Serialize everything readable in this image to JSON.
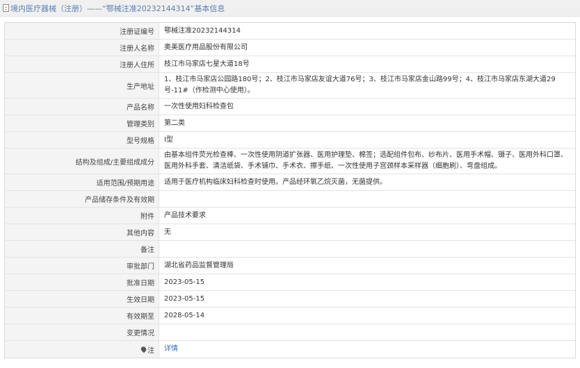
{
  "header": {
    "title": "境内医疗器械（注册）——“鄂械注准20232144314”基本信息"
  },
  "rows": [
    {
      "label": "注册证编号",
      "value": "鄂械注准20232144314"
    },
    {
      "label": "注册人名称",
      "value": "奥美医疗用品股份有限公司"
    },
    {
      "label": "注册人住所",
      "value": "枝江市马家店七星大道18号"
    },
    {
      "label": "生产地址",
      "value": "1、枝江市马家店公园路180号；2、枝江市马家店友谊大道76号；3、枝江市马家店金山路99号；4、枝江市马家店东湖大道29号-11#（作检测中心使用）。"
    },
    {
      "label": "产品名称",
      "value": "一次性使用妇科检查包"
    },
    {
      "label": "管理类别",
      "value": "第二类"
    },
    {
      "label": "型号规格",
      "value": "Ⅰ型"
    },
    {
      "label": "结构及组成/主要组成成分",
      "value": "由基本组件荧光检查棒、一次性使用阴道扩张器、医用护理垫、棉签；选配组件包布、纱布片、医用手术帽、镊子、医用外科口罩、医用外科手套、清洁纸袋、手术铺巾、手术衣、擦手纸、一次性使用子宫颈样本采样器（细胞刷）、弯盘组成。"
    },
    {
      "label": "适用范围/预期用途",
      "value": "适用于医疗机构临床妇科检查时使用。产品经环氧乙烷灭菌，无菌提供。"
    },
    {
      "label": "产品储存条件及有效期",
      "value": ""
    },
    {
      "label": "附件",
      "value": "产品技术要求"
    },
    {
      "label": "其他内容",
      "value": "无"
    },
    {
      "label": "备注",
      "value": ""
    },
    {
      "label": "审批部门",
      "value": "湖北省药品监督管理局"
    },
    {
      "label": "批准日期",
      "value": "2023-05-15"
    },
    {
      "label": "生效日期",
      "value": "2023-05-15"
    },
    {
      "label": "有效期至",
      "value": "2028-05-14"
    },
    {
      "label": "变更情况",
      "value": ""
    },
    {
      "label": "注",
      "value": "详情",
      "icon": "pin-icon",
      "link": true
    }
  ]
}
